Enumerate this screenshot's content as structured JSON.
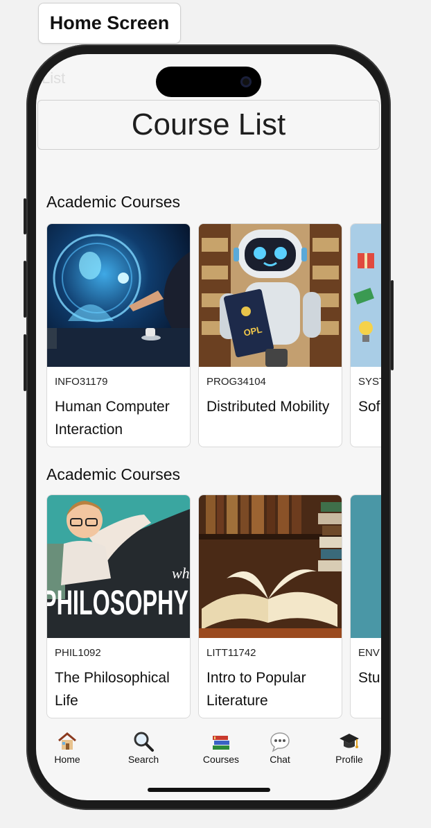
{
  "frame_label": "Home Screen",
  "header": {
    "title": "Course List"
  },
  "sections": [
    {
      "title": "Academic Courses",
      "courses": [
        {
          "code": "INFO31179",
          "title": "Human Computer Interaction"
        },
        {
          "code": "PROG34104",
          "title": "Distributed Mobility"
        },
        {
          "code": "SYST",
          "title": "Sof Eng"
        }
      ]
    },
    {
      "title": "Academic Courses",
      "courses": [
        {
          "code": "PHIL1092",
          "title": "The Philosophical Life"
        },
        {
          "code": "LITT11742",
          "title": "Intro to Popular Literature"
        },
        {
          "code": "ENV",
          "title": "Stu in E"
        }
      ]
    }
  ],
  "image_text": {
    "robot_book": "OPL",
    "philosophy_big": "PHILOSOPHY",
    "philosophy_small": "wh"
  },
  "nav": [
    {
      "label": "Home",
      "icon": "house-icon"
    },
    {
      "label": "Search",
      "icon": "magnifier-icon"
    },
    {
      "label": "Courses",
      "icon": "books-icon"
    },
    {
      "label": "Chat",
      "icon": "speech-bubble-icon"
    },
    {
      "label": "Profile",
      "icon": "graduation-cap-icon"
    }
  ],
  "colors": {
    "background": "#f6f6f6",
    "card_border": "#d9d9d9",
    "phone_frame": "#1b1b1b"
  }
}
